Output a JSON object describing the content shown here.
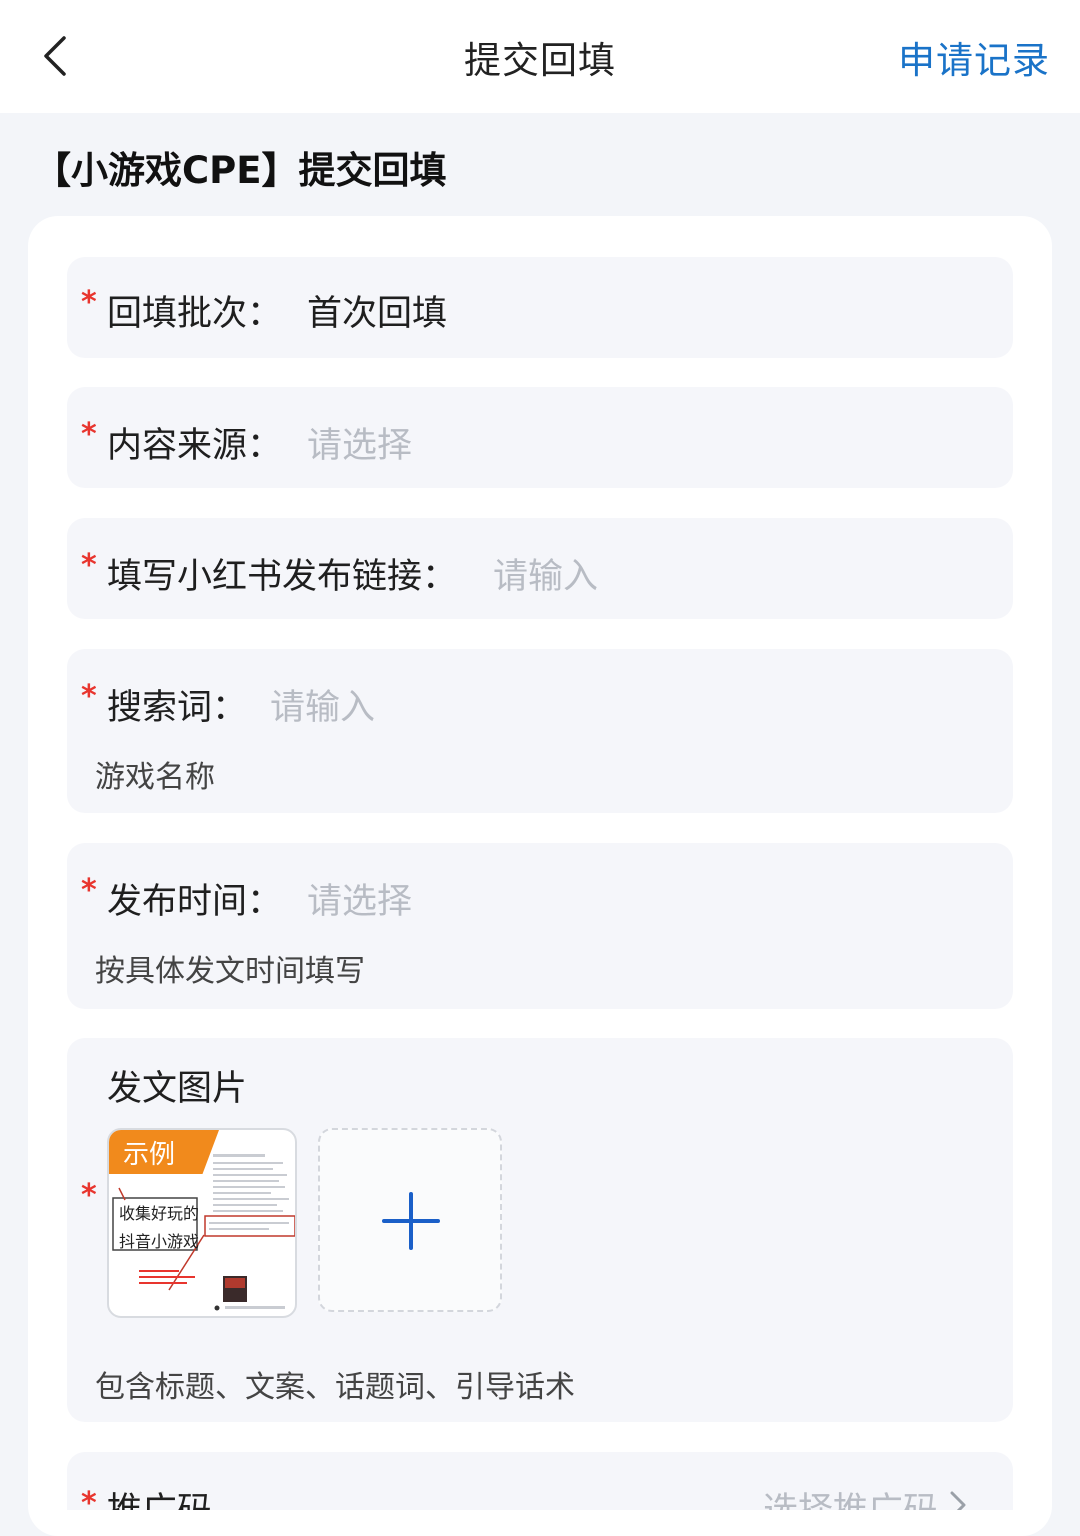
{
  "nav": {
    "back_icon": "chevron-left-icon",
    "title": "提交回填",
    "action": "申请记录"
  },
  "heading": "【小游戏CPE】提交回填",
  "fields": {
    "batch": {
      "required": "*",
      "label": "回填批次：",
      "value": "首次回填"
    },
    "source": {
      "required": "*",
      "label": "内容来源：",
      "placeholder": "请选择"
    },
    "link": {
      "required": "*",
      "label": "填写小红书发布链接：",
      "placeholder": "请输入"
    },
    "keyword": {
      "required": "*",
      "label": "搜索词：",
      "placeholder": "请输入",
      "hint": "游戏名称"
    },
    "time": {
      "required": "*",
      "label": "发布时间：",
      "placeholder": "请选择",
      "hint": "按具体发文时间填写"
    },
    "images": {
      "required": "*",
      "label": "发文图片",
      "example_tag": "示例",
      "example_handwriting_1": "收集好玩的",
      "example_handwriting_2": "抖音小游戏",
      "upload_icon": "plus-icon",
      "hint": "包含标题、文案、话题词、引导话术"
    },
    "promo": {
      "required": "*",
      "label": "推广码",
      "placeholder": "选择推广码"
    }
  },
  "colors": {
    "accent": "#1a73c8",
    "required": "#e8352e",
    "example_tag": "#f18a1c"
  }
}
